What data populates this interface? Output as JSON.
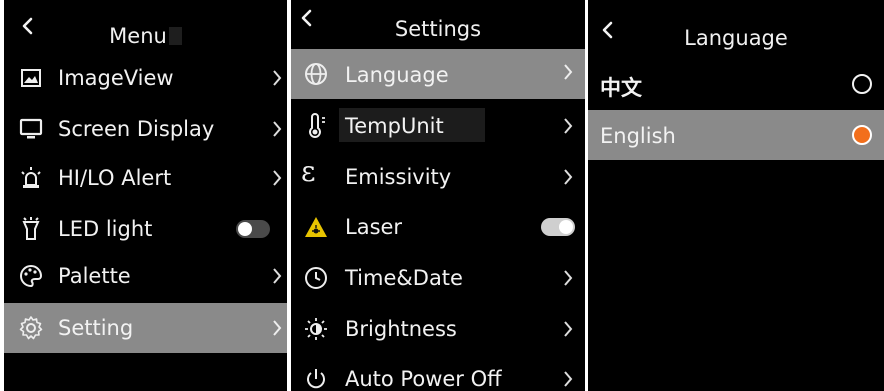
{
  "menu": {
    "title": "Menu",
    "items": [
      {
        "label": "ImageView",
        "icon": "image-icon"
      },
      {
        "label": "Screen Display",
        "icon": "monitor-icon"
      },
      {
        "label": "HI/LO Alert",
        "icon": "alarm-light-icon"
      },
      {
        "label": "LED light",
        "icon": "flashlight-icon",
        "toggle": false
      },
      {
        "label": "Palette",
        "icon": "palette-icon"
      },
      {
        "label": "Setting",
        "icon": "gear-icon",
        "selected": true
      }
    ]
  },
  "settings": {
    "title": "Settings",
    "items": [
      {
        "label": "Language",
        "icon": "globe-icon",
        "selected": true
      },
      {
        "label": "TempUnit",
        "icon": "thermometer-icon"
      },
      {
        "label": "Emissivity",
        "icon": "epsilon-icon"
      },
      {
        "label": "Laser",
        "icon": "laser-warning-icon",
        "toggle": true
      },
      {
        "label": "Time&Date",
        "icon": "clock-icon"
      },
      {
        "label": "Brightness",
        "icon": "brightness-icon"
      },
      {
        "label": "Auto Power Off",
        "icon": "power-icon"
      }
    ]
  },
  "language": {
    "title": "Language",
    "options": [
      {
        "label": "中文",
        "selected": false
      },
      {
        "label": "English",
        "selected": true
      }
    ]
  },
  "colors": {
    "background": "#000000",
    "selected_row": "#8a8a8a",
    "radio_selected": "#f26f1c",
    "laser_icon": "#e8c400"
  }
}
